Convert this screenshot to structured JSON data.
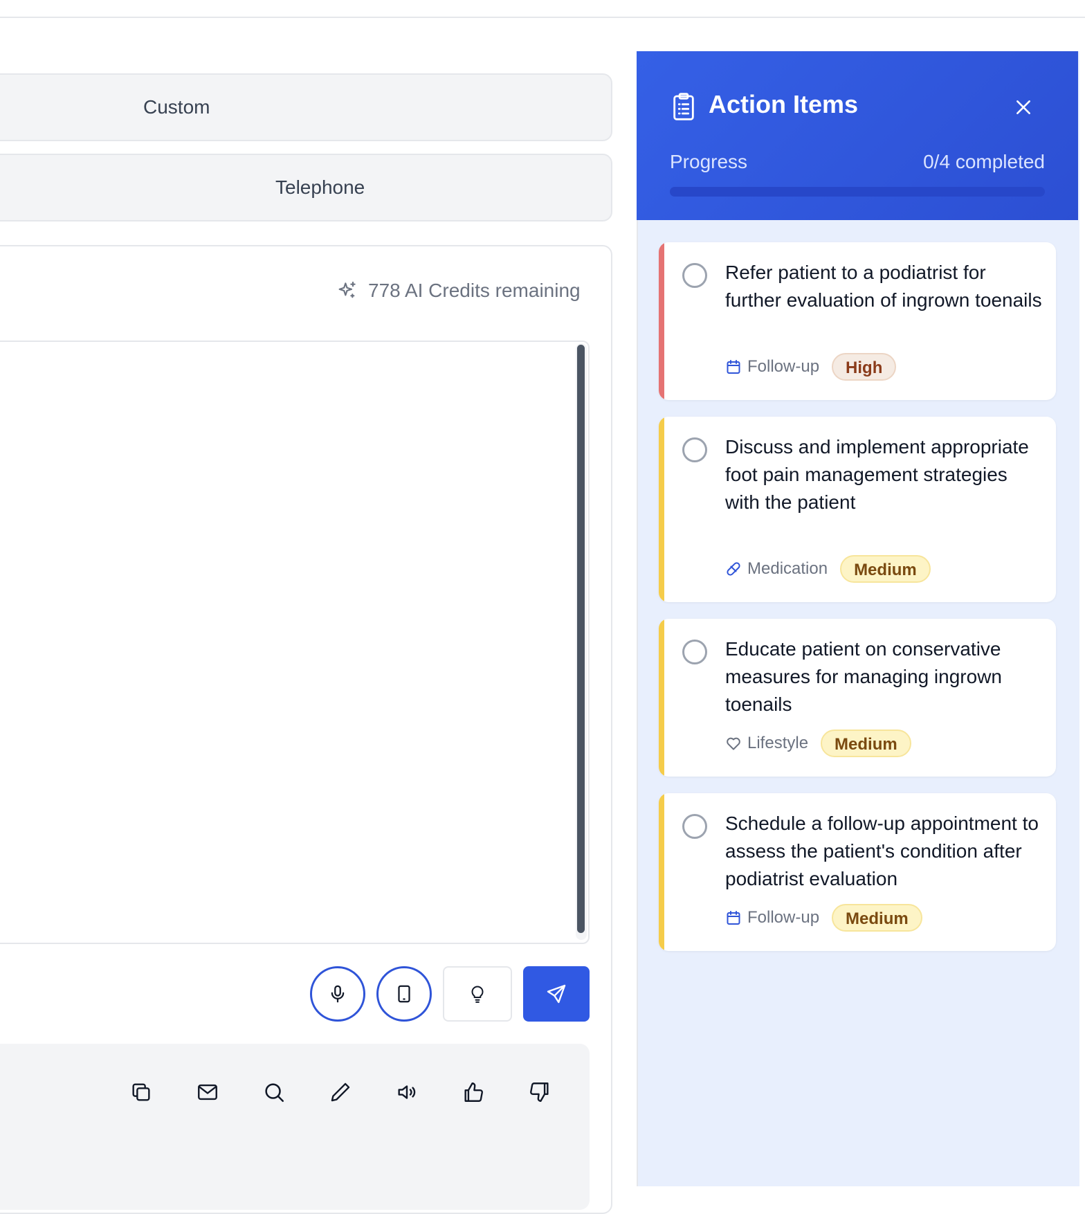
{
  "options": {
    "custom_label": "Custom",
    "telephone_label": "Telephone"
  },
  "composer": {
    "credits_text": "778 AI Credits remaining",
    "credits_icon": "sparkle-icon",
    "controls": [
      "microphone-icon",
      "tablet-icon",
      "lightbulb-icon",
      "send-icon"
    ]
  },
  "toolbar": {
    "icons": [
      "copy-icon",
      "mail-icon",
      "search-icon",
      "pencil-icon",
      "speaker-icon",
      "thumbs-up-icon",
      "thumbs-down-icon"
    ]
  },
  "panel": {
    "title": "Action Items",
    "title_icon": "clipboard-icon",
    "progress_label": "Progress",
    "progress_count": "0/4 completed",
    "progress_fraction": 0,
    "colors": {
      "header": "#3059e3",
      "high_stripe": "#e57373",
      "medium_stripe": "#f5cc4a"
    },
    "items": [
      {
        "text": "Refer patient to a podiatrist for further evaluation of ingrown toenails",
        "category": "Follow-up",
        "category_icon": "calendar-icon",
        "priority": "High",
        "completed": false
      },
      {
        "text": "Discuss and implement appropriate foot pain management strategies with the patient",
        "category": "Medication",
        "category_icon": "pill-icon",
        "priority": "Medium",
        "completed": false
      },
      {
        "text": "Educate patient on conservative measures for managing ingrown toenails",
        "category": "Lifestyle",
        "category_icon": "heart-icon",
        "priority": "Medium",
        "completed": false
      },
      {
        "text": "Schedule a follow-up appointment to assess the patient's condition after podiatrist evaluation",
        "category": "Follow-up",
        "category_icon": "calendar-icon",
        "priority": "Medium",
        "completed": false
      }
    ]
  }
}
